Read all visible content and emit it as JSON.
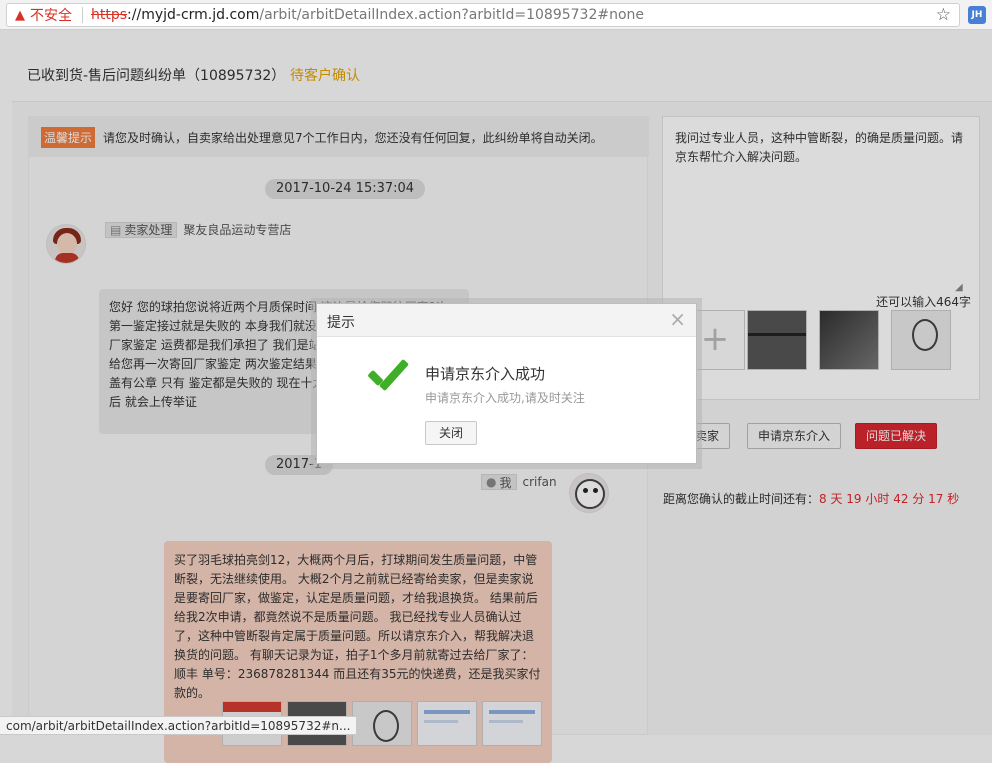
{
  "browser": {
    "insecure_label": "不安全",
    "url_scheme": "https",
    "url_host": "://myjd-crm.jd.com",
    "url_path": "/arbit/arbitDetailIndex.action?arbitId=10895732#none",
    "extension_label": "JH",
    "status_url": "com/arbit/arbitDetailIndex.action?arbitId=10895732#n..."
  },
  "header": {
    "title": "已收到货-售后问题纠纷单（10895732）",
    "status": "待客户确认"
  },
  "notice": {
    "tag": "温馨提示",
    "text": "请您及时确认，自卖家给出处理意见7个工作日内，您还没有任何回复，此纠纷单将自动关闭。"
  },
  "chat": {
    "time1": "2017-10-24 15:37:04",
    "time2": "2017-1",
    "seller_tag": "卖家处理",
    "seller_name": "聚友良品运动专营店",
    "seller_message": "您好 您的球拍您说将近两个月质保时间 这边是给您既往厂家2次第一鉴定接过就是失败的 本身我们就没有义务给您寄第二次 寄回厂家鉴定 运费都是我们承担了 我们是站在客户角度在给争取下 才给您再一次寄回厂家鉴定 两次鉴定结果 损坏 厂家也出具鉴定结果盖有公章 只有 鉴定都是失败的 现在十九大期间快递 发到我们以后 就会上传举证",
    "me_tag": "我",
    "me_name": "crifan",
    "my_message": "买了羽毛球拍亮剑12，大概两个月后，打球期间发生质量问题，中管断裂，无法继续使用。 大概2个月之前就已经寄给卖家，但是卖家说是要寄回厂家，做鉴定，认定是质量问题，才给我退换货。 结果前后给我2次申请，都竟然说不是质量问题。 我已经找专业人员确认过了，这种中管断裂肯定属于质量问题。所以请京东介入，帮我解决退换货的问题。 有聊天记录为证，拍子1个多月前就寄过去给厂家了：顺丰 单号：236878281344 而且还有35元的快递费，还是我买家付款的。"
  },
  "reply": {
    "text": "我问过专业人员，这种中管断裂，的确是质量问题。请京东帮忙介入解决问题。",
    "char_count": "还可以输入464字",
    "upload_symbol": "+"
  },
  "actions": {
    "contact_seller": "卖家",
    "request_jd": "申请京东介入",
    "resolved": "问题已解决"
  },
  "deadline": {
    "prefix": "距离您确认的截止时间还有：",
    "days": "8",
    "days_unit": " 天 ",
    "hours": "19",
    "hours_unit": " 小时 ",
    "minutes": "42",
    "minutes_unit": " 分 ",
    "seconds": "17",
    "seconds_unit": " 秒"
  },
  "modal": {
    "title": "提示",
    "heading": "申请京东介入成功",
    "description": "申请京东介入成功,请及时关注",
    "close_button": "关闭",
    "close_symbol": "×"
  },
  "colors": {
    "status_orange": "#e4a100",
    "notice_tag": "#f07b3c",
    "danger_red": "#d8262f",
    "success_green": "#3fae29",
    "my_bubble": "#f5d1c1"
  }
}
